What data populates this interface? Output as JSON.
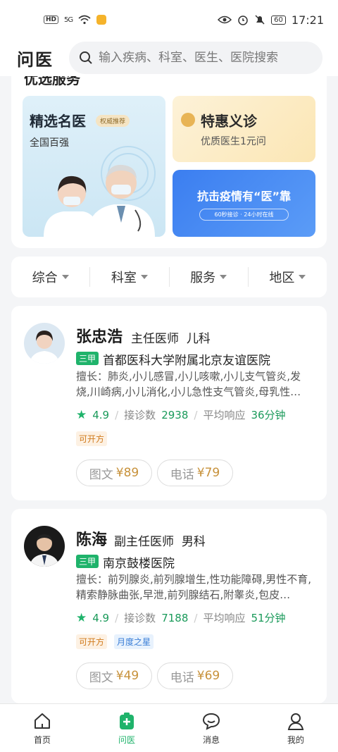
{
  "status_bar": {
    "hd": "HD",
    "signal": "5G",
    "battery": "60",
    "time": "17:21"
  },
  "header": {
    "title": "问医",
    "search_placeholder": "输入疾病、科室、医生、医院搜索"
  },
  "services": {
    "section_title": "优选服务",
    "famous": {
      "title": "精选名医",
      "badge": "权威推荐",
      "subtitle": "全国百强"
    },
    "discount": {
      "title": "特惠义诊",
      "subtitle": "优质医生1元问"
    },
    "epidemic": {
      "title": "抗击疫情有“医”靠",
      "subtitle": "60秒接诊 · 24小时在线"
    }
  },
  "filters": [
    "综合",
    "科室",
    "服务",
    "地区"
  ],
  "doctors": [
    {
      "name": "张忠浩",
      "title": "主任医师",
      "department": "儿科",
      "grade": "三甲",
      "hospital": "首都医科大学附属北京友谊医院",
      "specialty": "擅长：肺炎,小儿感冒,小儿咳嗽,小儿支气管炎,发烧,川崎病,小儿消化,小儿急性支气管炎,母乳性…",
      "rating": "4.9",
      "consult_label": "接诊数",
      "consults": "2938",
      "response_label": "平均响应",
      "response": "36分钟",
      "tags": [
        "可开方"
      ],
      "services": [
        {
          "label": "图文",
          "price": "¥89"
        },
        {
          "label": "电话",
          "price": "¥79"
        }
      ]
    },
    {
      "name": "陈海",
      "title": "副主任医师",
      "department": "男科",
      "grade": "三甲",
      "hospital": "南京鼓楼医院",
      "specialty": "擅长：前列腺炎,前列腺增生,性功能障碍,男性不育,精索静脉曲张,早泄,前列腺结石,附睾炎,包皮…",
      "rating": "4.9",
      "consult_label": "接诊数",
      "consults": "7188",
      "response_label": "平均响应",
      "response": "51分钟",
      "tags": [
        "可开方",
        "月度之星"
      ],
      "services": [
        {
          "label": "图文",
          "price": "¥49"
        },
        {
          "label": "电话",
          "price": "¥69"
        }
      ]
    }
  ],
  "tabbar": {
    "items": [
      {
        "label": "首页",
        "icon": "home-icon"
      },
      {
        "label": "问医",
        "icon": "medkit-icon",
        "active": true
      },
      {
        "label": "消息",
        "icon": "chat-icon"
      },
      {
        "label": "我的",
        "icon": "user-icon"
      }
    ]
  },
  "colors": {
    "accent": "#1fb36b",
    "price": "#c7913a",
    "blue_banner": "#3b7ef0"
  }
}
